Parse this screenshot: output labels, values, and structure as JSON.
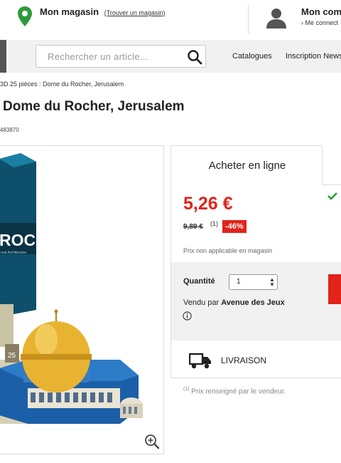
{
  "header": {
    "store_title": "Mon magasin",
    "store_link": "(Trouver un magasin)",
    "account_title": "Mon comp",
    "account_sub": "› Me connect"
  },
  "nav": {
    "search_placeholder": "Rechercher un article...",
    "items": [
      "Catalogues",
      "Inscription News"
    ]
  },
  "breadcrumb": "3D 25 pièces : Dome du Rocher, Jerusalem",
  "product": {
    "title": "Dome du Rocher, Jerusalem",
    "ref": "483870",
    "box_text": "ROCK",
    "box_subtext": "real Architecture",
    "piece_count": "25"
  },
  "buy": {
    "tab_label": "Acheter en ligne",
    "price": "5,26 €",
    "old_price": "9,89 €",
    "note_marker": "(1)",
    "discount": "-46%",
    "not_in_store": "Prix non applicable en magasin",
    "quantity_label": "Quantité",
    "quantity_value": "1",
    "sold_by_prefix": "Vendu par",
    "sold_by_seller": "Avenue des Jeux",
    "delivery_label": "LIVRAISON",
    "footnote_marker": "(1)",
    "footnote_text": "Prix renseigné par le vendeur."
  },
  "colors": {
    "accent_red": "#e2231a",
    "pin_green": "#2e9a3a",
    "check_green": "#27a132"
  }
}
